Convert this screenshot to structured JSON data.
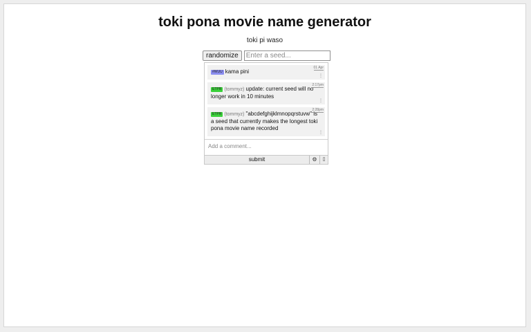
{
  "page": {
    "title": "toki pona movie name generator",
    "subtitle": "toki pi waso"
  },
  "controls": {
    "randomize_label": "randomize",
    "seed_placeholder": "Enter a seed..."
  },
  "chat": {
    "comments": [
      {
        "badge": "#WUU",
        "badge_color": "#8a8df0",
        "user": "",
        "text": "kama pini",
        "time": "01 Apr",
        "menu_icon": "more-icon"
      },
      {
        "badge": "ETPR",
        "badge_color": "#3ad13a",
        "user": "(tommyz)",
        "text": "update: current seed will no longer work in 10 minutes",
        "time": "2:17pm",
        "menu_icon": "more-icon"
      },
      {
        "badge": "ETPR",
        "badge_color": "#3ad13a",
        "user": "(tommyz)",
        "text": "\"abcdefghijklmnopqrstuvw\" is a seed that currently makes the longest toki pona movie name recorded",
        "time": "2:28pm",
        "menu_icon": "more-icon"
      }
    ],
    "comment_placeholder": "Add a comment...",
    "submit_label": "submit",
    "settings_icon": "gear-icon",
    "info_icon": "info-icon"
  }
}
